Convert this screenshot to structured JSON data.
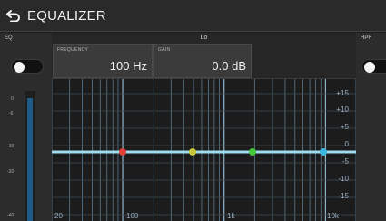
{
  "header": {
    "title": "EQUALIZER",
    "back_icon": "return-arrow-icon"
  },
  "eq": {
    "label": "EQ",
    "toggle_on": false
  },
  "hpf": {
    "label": "HPF",
    "toggle_on": false
  },
  "band": {
    "name": "Lo"
  },
  "frequency": {
    "label": "FREQUENCY",
    "value": "100 Hz"
  },
  "gain": {
    "label": "GAIN",
    "value": "0.0 dB"
  },
  "meter": {
    "ticks": [
      "0",
      "-6",
      "-20",
      "-30",
      "-40"
    ]
  },
  "graph": {
    "gain_ticks": [
      "+15",
      "+10",
      "+5",
      "0",
      "-5",
      "-10",
      "-15"
    ],
    "freq_ticks": [
      "20",
      "100",
      "1k",
      "10k"
    ],
    "curve_color": "#9fdcf0",
    "points": [
      {
        "band": "lo",
        "color": "#e0413a"
      },
      {
        "band": "lo-mid",
        "color": "#c8c83a"
      },
      {
        "band": "hi-mid",
        "color": "#45c83a"
      },
      {
        "band": "hi",
        "color": "#3ab8e0"
      }
    ]
  }
}
